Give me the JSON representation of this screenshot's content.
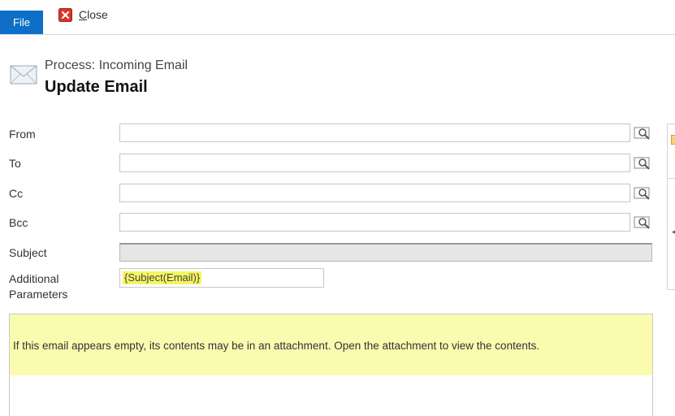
{
  "ribbon": {
    "file_label": "File",
    "close_label_prefix": "C",
    "close_label_rest": "lose"
  },
  "header": {
    "subtitle": "Process: Incoming Email",
    "title": "Update Email"
  },
  "form": {
    "from_label": "From",
    "to_label": "To",
    "cc_label": "Cc",
    "bcc_label": "Bcc",
    "subject_label": "Subject",
    "additional_label_line1": "Additional",
    "additional_label_line2": "Parameters",
    "additional_value": "{Subject(Email)}"
  },
  "notice": {
    "text": "If this email appears empty, its contents may be in an attachment. Open the attachment to view the contents."
  },
  "colors": {
    "file_tab": "#0f6fc6",
    "notice_bg": "#fbfbb0",
    "highlight": "#f5f562"
  }
}
